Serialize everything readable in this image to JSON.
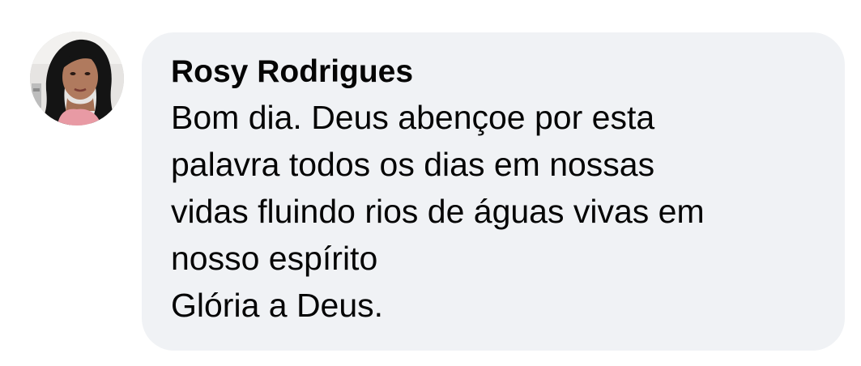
{
  "comment": {
    "author": "Rosy Rodrigues",
    "avatar_icon": "profile-photo-woman",
    "lines": [
      "Bom dia. Deus abençoe por esta",
      "palavra todos os dias em nossas",
      "vidas fluindo rios de águas vivas em",
      "nosso espírito",
      "Glória a Deus."
    ]
  },
  "colors": {
    "bubble_background": "#f0f2f5",
    "text": "#050505"
  }
}
